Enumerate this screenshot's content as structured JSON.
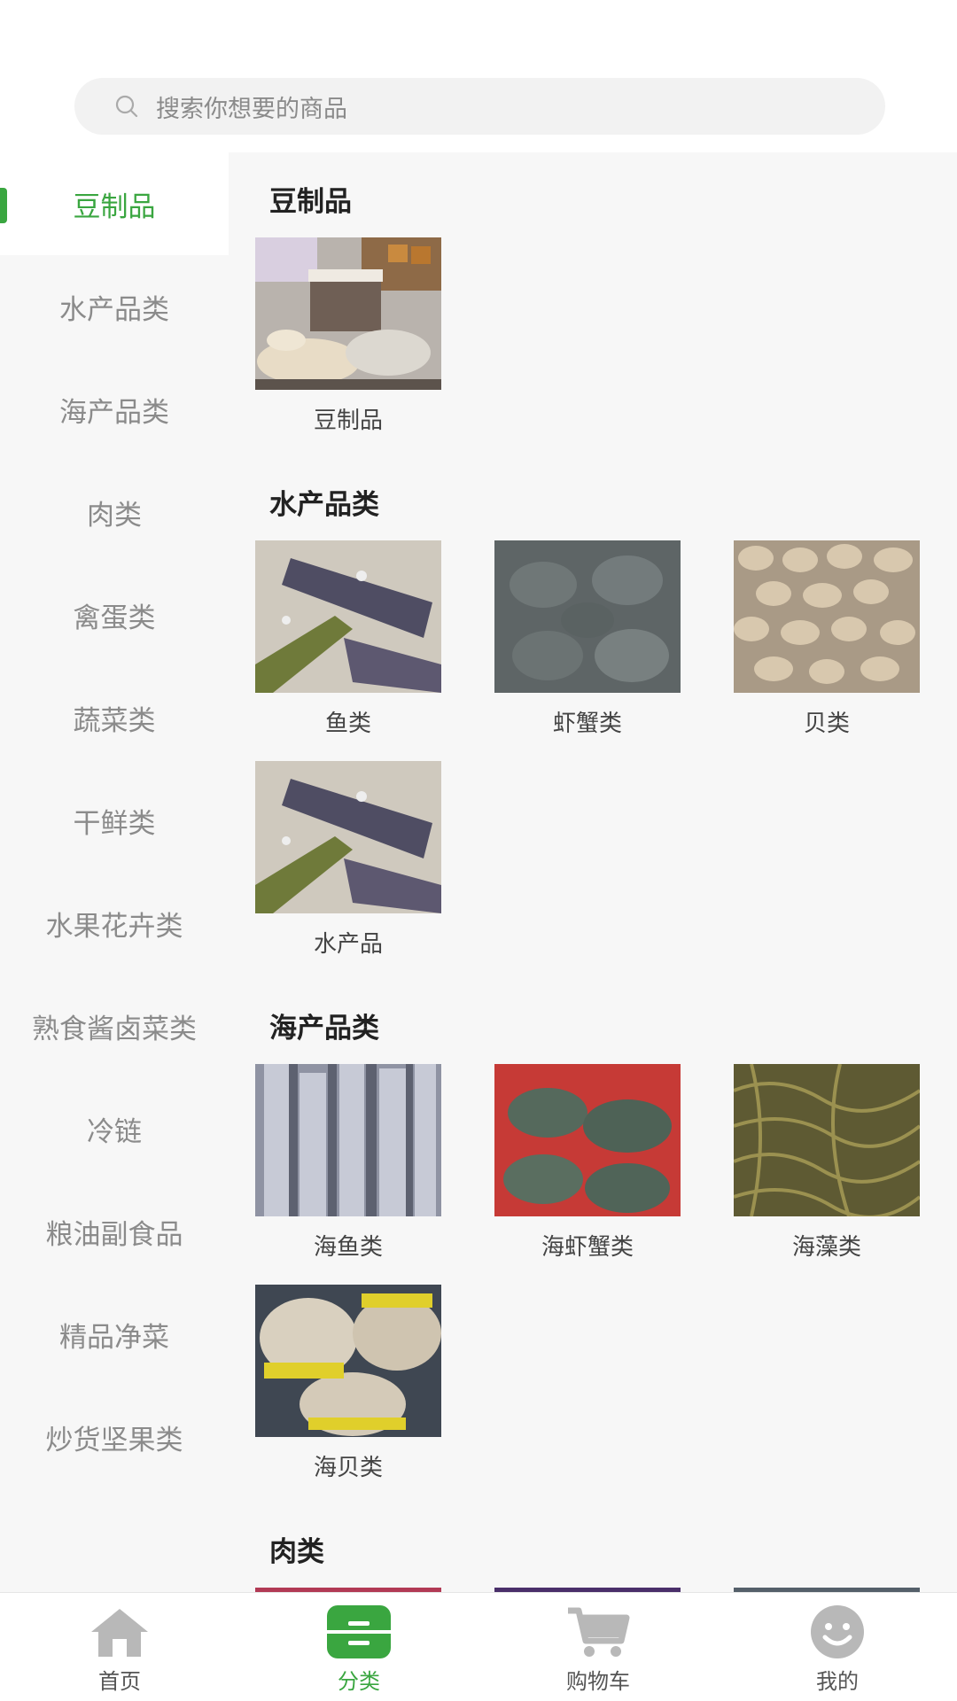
{
  "search": {
    "placeholder": "搜索你想要的商品"
  },
  "sidebar": {
    "items": [
      {
        "label": "豆制品"
      },
      {
        "label": "水产品类"
      },
      {
        "label": "海产品类"
      },
      {
        "label": "肉类"
      },
      {
        "label": "禽蛋类"
      },
      {
        "label": "蔬菜类"
      },
      {
        "label": "干鲜类"
      },
      {
        "label": "水果花卉类"
      },
      {
        "label": "熟食酱卤菜类"
      },
      {
        "label": "冷链"
      },
      {
        "label": "粮油副食品"
      },
      {
        "label": "精品净菜"
      },
      {
        "label": "炒货坚果类"
      }
    ],
    "active_index": 0
  },
  "sections": [
    {
      "title": "豆制品",
      "items": [
        {
          "label": "豆制品",
          "image": "tofu-products-photo"
        }
      ]
    },
    {
      "title": "水产品类",
      "items": [
        {
          "label": "鱼类",
          "image": "fish-photo"
        },
        {
          "label": "虾蟹类",
          "image": "crabs-photo"
        },
        {
          "label": "贝类",
          "image": "clams-photo"
        },
        {
          "label": "水产品",
          "image": "fish-photo"
        }
      ]
    },
    {
      "title": "海产品类",
      "items": [
        {
          "label": "海鱼类",
          "image": "hairtail-fish-photo"
        },
        {
          "label": "海虾蟹类",
          "image": "sea-crabs-photo"
        },
        {
          "label": "海藻类",
          "image": "seaweed-photo"
        },
        {
          "label": "海贝类",
          "image": "packaged-shellfish-photo"
        }
      ]
    },
    {
      "title": "肉类",
      "items": []
    }
  ],
  "tabbar": {
    "items": [
      {
        "label": "首页",
        "icon": "home-icon"
      },
      {
        "label": "分类",
        "icon": "category-icon"
      },
      {
        "label": "购物车",
        "icon": "cart-icon"
      },
      {
        "label": "我的",
        "icon": "profile-icon"
      }
    ],
    "active_index": 1
  },
  "colors": {
    "accent": "#3aa640",
    "inactive_icon": "#b8b8b8"
  }
}
